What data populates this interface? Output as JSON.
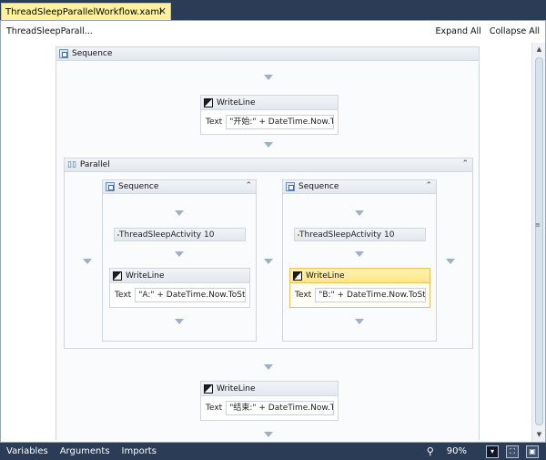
{
  "document_tab": {
    "title": "ThreadSleepParallelWorkflow.xaml",
    "close": "✕"
  },
  "breadcrumb": "ThreadSleepParall...",
  "actions": {
    "expand_all": "Expand All",
    "collapse_all": "Collapse All"
  },
  "workflow": {
    "root": {
      "type": "Sequence"
    },
    "writeline_start": {
      "title": "WriteLine",
      "text_label": "Text",
      "text_value": "\"开始:\" + DateTime.Now.To"
    },
    "parallel": {
      "title": "Parallel"
    },
    "branch_a": {
      "title": "Sequence",
      "thread_sleep": "ThreadSleepActivity 10",
      "writeline": {
        "title": "WriteLine",
        "text_label": "Text",
        "text_value": "\"A:\" + DateTime.Now.ToStr"
      }
    },
    "branch_b": {
      "title": "Sequence",
      "thread_sleep": "ThreadSleepActivity 10",
      "writeline": {
        "title": "WriteLine",
        "text_label": "Text",
        "text_value": "\"B:\" + DateTime.Now.ToStr",
        "selected": true
      }
    },
    "writeline_end": {
      "title": "WriteLine",
      "text_label": "Text",
      "text_value": "\"结束:\" + DateTime.Now.To"
    }
  },
  "statusbar": {
    "tabs": [
      "Variables",
      "Arguments",
      "Imports"
    ],
    "zoom": "90%"
  },
  "icons": {
    "sequence": "sequence-icon",
    "parallel": "parallel-icon",
    "writeline": "writeline-icon",
    "thread_sleep": "activity-icon",
    "collapse": "double-chevron-up-icon",
    "zoom": "magnifier-icon"
  },
  "colors": {
    "tab_active": "#fff29d",
    "chrome": "#2b3c57",
    "selected_activity": "#ffe58a"
  }
}
